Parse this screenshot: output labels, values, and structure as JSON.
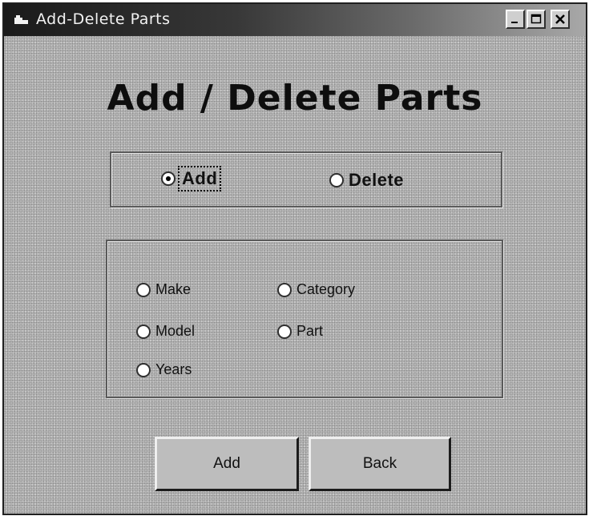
{
  "window": {
    "title": "Add-Delete Parts",
    "controls": [
      "minimize-icon",
      "maximize-icon",
      "close-icon"
    ]
  },
  "heading": "Add / Delete Parts",
  "mode_options": [
    {
      "label": "Add",
      "selected": true
    },
    {
      "label": "Delete",
      "selected": false
    }
  ],
  "type_options": [
    {
      "label": "Make",
      "selected": false
    },
    {
      "label": "Category",
      "selected": false
    },
    {
      "label": "Model",
      "selected": false
    },
    {
      "label": "Part",
      "selected": false
    },
    {
      "label": "Years",
      "selected": false
    }
  ],
  "buttons": {
    "add_label": "Add",
    "back_label": "Back"
  }
}
